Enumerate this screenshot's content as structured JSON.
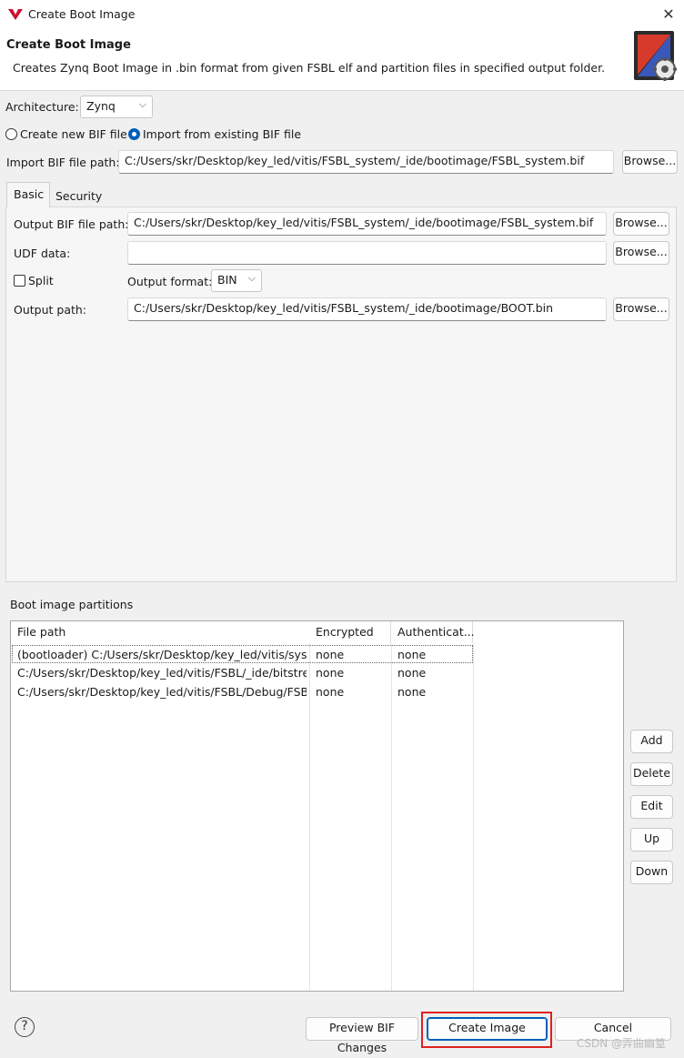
{
  "window": {
    "title": "Create Boot Image",
    "close": "✕"
  },
  "header": {
    "title": "Create Boot Image",
    "description": "Creates Zynq Boot Image in .bin format from given FSBL elf and partition files in specified output folder."
  },
  "architecture": {
    "label": "Architecture:",
    "value": "Zynq"
  },
  "bif_mode": {
    "create_new": "Create new BIF file",
    "import_existing": "Import from existing BIF file",
    "selected": "import_existing"
  },
  "import_bif": {
    "label": "Import BIF file path:",
    "value": "C:/Users/skr/Desktop/key_led/vitis/FSBL_system/_ide/bootimage/FSBL_system.bif",
    "browse": "Browse..."
  },
  "tabs": [
    {
      "label": "Basic",
      "active": true
    },
    {
      "label": "Security",
      "active": false
    }
  ],
  "basic": {
    "output_bif_label": "Output BIF file path:",
    "output_bif_value": "C:/Users/skr/Desktop/key_led/vitis/FSBL_system/_ide/bootimage/FSBL_system.bif",
    "udf_label": "UDF data:",
    "udf_value": "",
    "split_label": "Split",
    "split_checked": false,
    "output_format_label": "Output format:",
    "output_format_value": "BIN",
    "output_path_label": "Output path:",
    "output_path_value": "C:/Users/skr/Desktop/key_led/vitis/FSBL_system/_ide/bootimage/BOOT.bin",
    "browse": "Browse..."
  },
  "partitions": {
    "label": "Boot image partitions",
    "columns": [
      "File path",
      "Encrypted",
      "Authenticat..."
    ],
    "rows": [
      {
        "path": "(bootloader) C:/Users/skr/Desktop/key_led/vitis/syst...",
        "encrypted": "none",
        "auth": "none"
      },
      {
        "path": "C:/Users/skr/Desktop/key_led/vitis/FSBL/_ide/bitstre...",
        "encrypted": "none",
        "auth": "none"
      },
      {
        "path": "C:/Users/skr/Desktop/key_led/vitis/FSBL/Debug/FSB...",
        "encrypted": "none",
        "auth": "none"
      }
    ],
    "buttons": {
      "add": "Add",
      "delete": "Delete",
      "edit": "Edit",
      "up": "Up",
      "down": "Down"
    }
  },
  "footer": {
    "help": "?",
    "preview": "Preview BIF Changes",
    "create": "Create Image",
    "cancel": "Cancel"
  },
  "watermark": "CSDN @弄曲幽篁",
  "colors": {
    "accent": "#005fb8",
    "highlight": "#e02020"
  },
  "icons": {
    "app": "vitis-logo-icon",
    "header": "boot-image-gear-icon",
    "combo": "chevron-down-icon"
  }
}
